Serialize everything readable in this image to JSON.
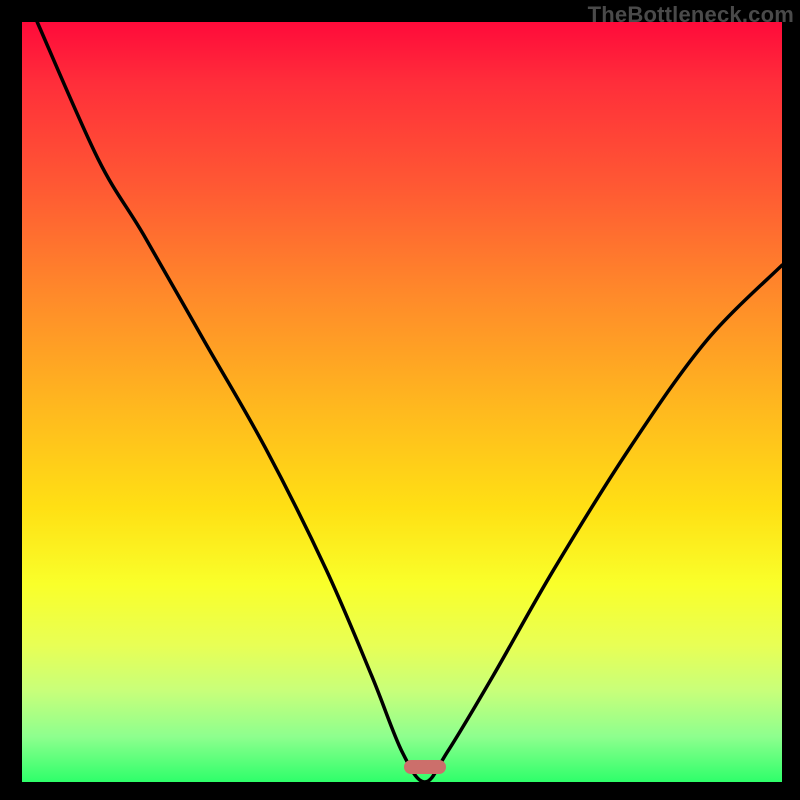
{
  "watermark": "TheBottleneck.com",
  "chart_data": {
    "type": "line",
    "title": "",
    "xlabel": "",
    "ylabel": "",
    "xlim": [
      0,
      100
    ],
    "ylim": [
      0,
      100
    ],
    "series": [
      {
        "name": "bottleneck-curve",
        "x": [
          2,
          10,
          16,
          24,
          32,
          40,
          46,
          50,
          53,
          56,
          62,
          70,
          80,
          90,
          100
        ],
        "y": [
          100,
          82,
          72,
          58,
          44,
          28,
          14,
          4,
          0,
          4,
          14,
          28,
          44,
          58,
          68
        ]
      }
    ],
    "marker": {
      "x": 53,
      "y": 2,
      "color": "#cc6f6b"
    },
    "gradient_stops": [
      {
        "pos": 0,
        "color": "#ff0a3a"
      },
      {
        "pos": 8,
        "color": "#ff2e3a"
      },
      {
        "pos": 22,
        "color": "#ff5a33"
      },
      {
        "pos": 36,
        "color": "#ff8a2a"
      },
      {
        "pos": 50,
        "color": "#ffb61f"
      },
      {
        "pos": 64,
        "color": "#ffe014"
      },
      {
        "pos": 74,
        "color": "#f9ff2a"
      },
      {
        "pos": 82,
        "color": "#e8ff55"
      },
      {
        "pos": 88,
        "color": "#c8ff7a"
      },
      {
        "pos": 94,
        "color": "#8eff8e"
      },
      {
        "pos": 100,
        "color": "#2eff6a"
      }
    ]
  }
}
